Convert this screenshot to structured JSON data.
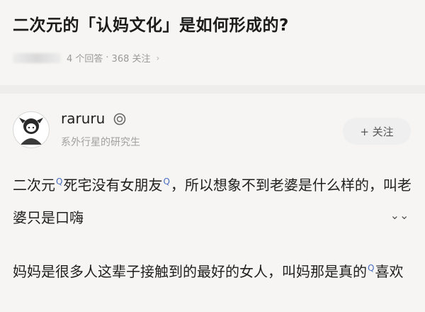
{
  "question": {
    "title": "二次元的「认妈文化」是如何形成的?",
    "answer_count": "4 个回答",
    "separator": "·",
    "follower_count": "368 关注",
    "chevron": "›"
  },
  "author": {
    "name": "raruru",
    "bio": "系外行星的研究生",
    "avatar_icon": "anime-girl-avatar",
    "verify_icon": "verified-badge-icon"
  },
  "actions": {
    "follow_label": "+ 关注",
    "expand_icon": "double-chevron-down-icon",
    "expand_glyph": "⌄⌄"
  },
  "answer": {
    "p1_seg1": "二次元",
    "p1_seg2": "死宅没有女朋友",
    "p1_seg3": "，所以想象不到老婆是什么样的，叫老婆只是口嗨",
    "p2_seg1": "妈妈是很多人这辈子接触到的最好的女人，叫妈那是真的",
    "p2_seg2": "喜欢",
    "search_mark": "Q"
  },
  "colors": {
    "background": "#f6f5f3",
    "title": "#1b1b1b",
    "meta": "#9a9a9a",
    "search_link": "#4a6fbf"
  }
}
